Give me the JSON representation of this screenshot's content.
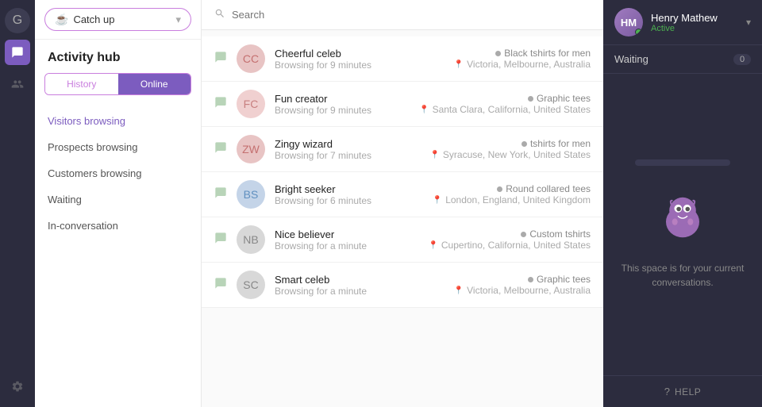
{
  "iconSidebar": {
    "logo": "G",
    "navIcons": [
      {
        "name": "chat-nav-icon",
        "icon": "💬",
        "active": true
      },
      {
        "name": "contacts-nav-icon",
        "icon": "👥",
        "active": false
      },
      {
        "name": "settings-nav-icon",
        "icon": "⚙",
        "active": false
      }
    ]
  },
  "header": {
    "catchUpLabel": "Catch up",
    "searchPlaceholder": "Search"
  },
  "activityHub": {
    "title": "Activity hub",
    "tabs": [
      {
        "label": "History",
        "active": false
      },
      {
        "label": "Online",
        "active": true
      }
    ]
  },
  "navItems": [
    {
      "label": "Visitors browsing",
      "active": true
    },
    {
      "label": "Prospects browsing",
      "active": false
    },
    {
      "label": "Customers browsing",
      "active": false
    },
    {
      "label": "Waiting",
      "active": false
    },
    {
      "label": "In-conversation",
      "active": false
    }
  ],
  "visitors": [
    {
      "name": "Cheerful celeb",
      "time": "Browsing for 9 minutes",
      "avatarBg": "#e8c4c4",
      "avatarColor": "#c47070",
      "initials": "CC",
      "product": "Black tshirts for men",
      "location": "Victoria, Melbourne, Australia"
    },
    {
      "name": "Fun creator",
      "time": "Browsing for 9 minutes",
      "avatarBg": "#f0d0d0",
      "avatarColor": "#c88080",
      "initials": "FC",
      "product": "Graphic tees",
      "location": "Santa Clara, California, United States"
    },
    {
      "name": "Zingy wizard",
      "time": "Browsing for 7 minutes",
      "avatarBg": "#e8c4c4",
      "avatarColor": "#c47070",
      "initials": "ZW",
      "product": "tshirts for men",
      "location": "Syracuse, New York, United States"
    },
    {
      "name": "Bright seeker",
      "time": "Browsing for 6 minutes",
      "avatarBg": "#c4d4e8",
      "avatarColor": "#6090c0",
      "initials": "BS",
      "product": "Round collared tees",
      "location": "London, England, United Kingdom"
    },
    {
      "name": "Nice believer",
      "time": "Browsing for a minute",
      "avatarBg": "#d8d8d8",
      "avatarColor": "#888",
      "initials": "NB",
      "product": "Custom tshirts",
      "location": "Cupertino, California, United States"
    },
    {
      "name": "Smart celeb",
      "time": "Browsing for a minute",
      "avatarBg": "#d8d8d8",
      "avatarColor": "#888",
      "initials": "SC",
      "product": "Graphic tees",
      "location": "Victoria, Melbourne, Australia"
    }
  ],
  "rightPanel": {
    "userName": "Henry Mathew",
    "userStatus": "Active",
    "waitingLabel": "Waiting",
    "waitingCount": "0",
    "placeholderText": "This space is for your current conversations.",
    "helpLabel": "HELP"
  }
}
